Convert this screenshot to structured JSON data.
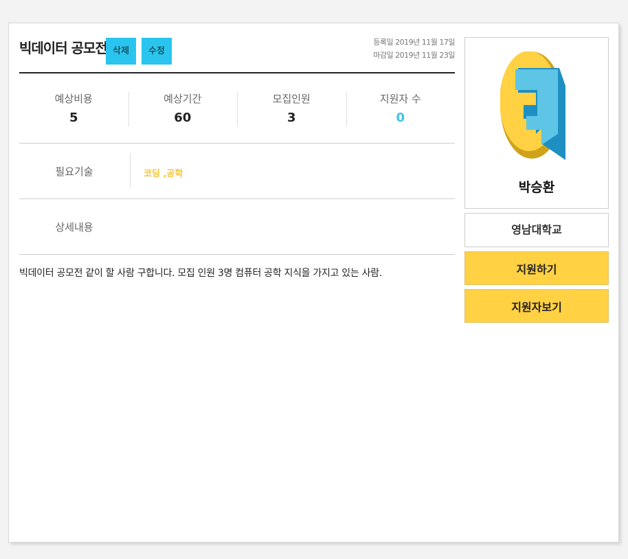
{
  "post": {
    "title": "빅데이터 공모전",
    "delete_label": "삭제",
    "edit_label": "수정",
    "registered_date": "등록일 2019년 11월 17일",
    "deadline_date": "마감일 2019년 11월 23일"
  },
  "stats": [
    {
      "label": "예상비용",
      "value": "5"
    },
    {
      "label": "예상기간",
      "value": "60"
    },
    {
      "label": "모집인원",
      "value": "3"
    },
    {
      "label": "지원자 수",
      "value": "0"
    }
  ],
  "skills": {
    "label": "필요기술",
    "value": "코딩 ,공학"
  },
  "details": {
    "label": "상세내용",
    "text": "빅데이터 공모전 같이 할 사람 구합니다. 모집 인원 3명 컴퓨터 공학 지식을 가지고 있는 사람."
  },
  "profile": {
    "logo_icon": "e-letter-logo-icon",
    "name": "박승환",
    "school": "영남대학교"
  },
  "actions": {
    "apply_label": "지원하기",
    "view_applicants_label": "지원자보기"
  },
  "colors": {
    "accent_blue": "#29c5ee",
    "applicant_count": "#3ec3e6",
    "skill_yellow": "#f5c33b",
    "button_yellow": "#ffd143"
  }
}
